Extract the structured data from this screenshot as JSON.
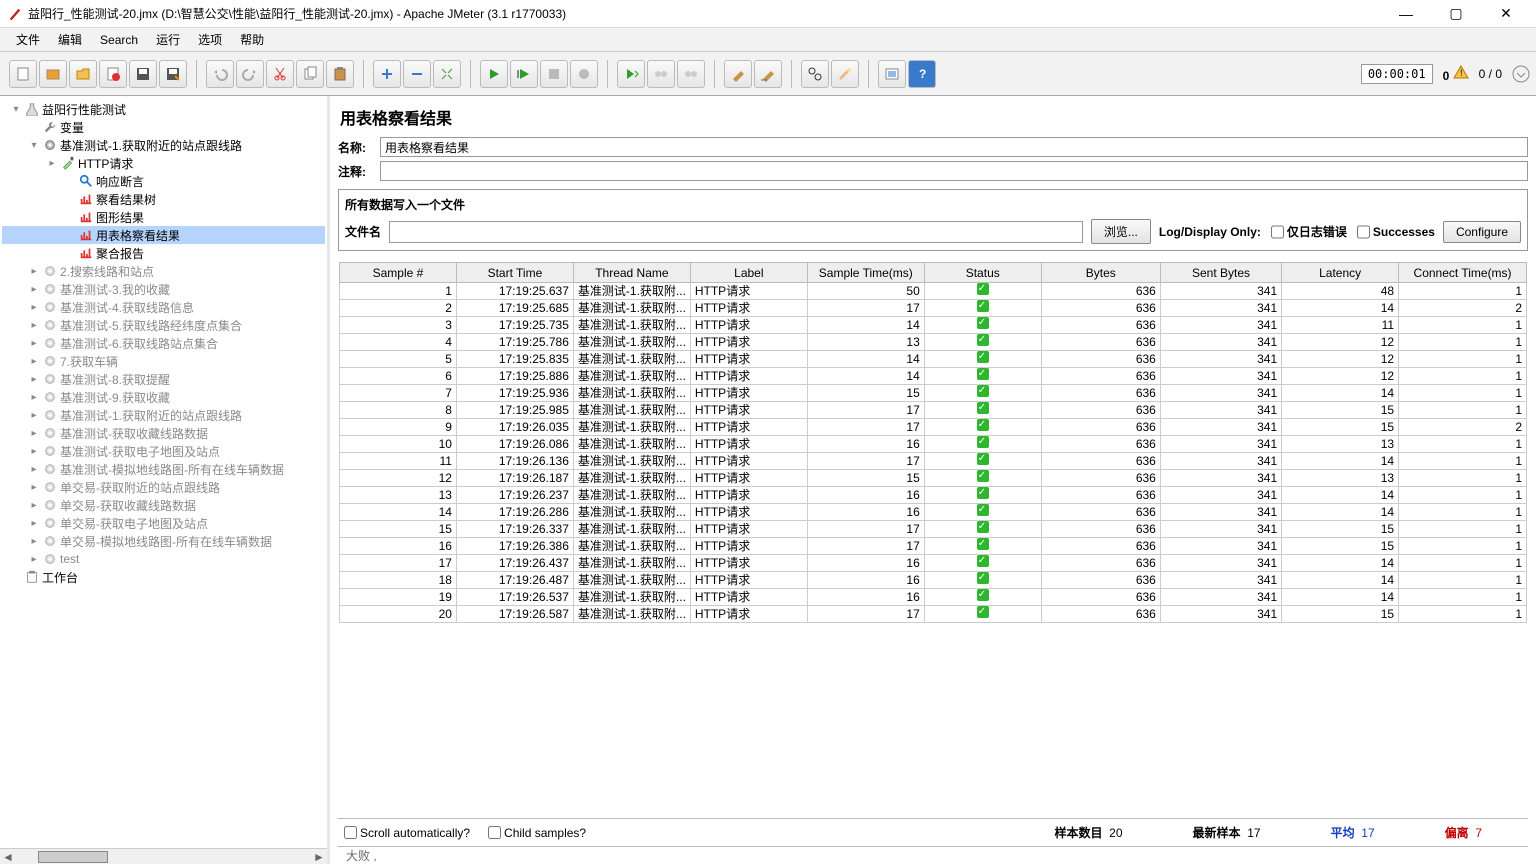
{
  "window": {
    "title": "益阳行_性能测试-20.jmx (D:\\智慧公交\\性能\\益阳行_性能测试-20.jmx) - Apache JMeter (3.1 r1770033)"
  },
  "menu": [
    "文件",
    "编辑",
    "Search",
    "运行",
    "选项",
    "帮助"
  ],
  "status": {
    "timer": "00:00:01",
    "warn_count": "0",
    "threads": "0 / 0"
  },
  "tree": [
    {
      "d": 0,
      "t": "▾",
      "ic": "flask",
      "lbl": "益阳行性能测试"
    },
    {
      "d": 1,
      "t": "",
      "ic": "wrench",
      "lbl": "变量"
    },
    {
      "d": 1,
      "t": "▾",
      "ic": "gear",
      "lbl": "基准测试-1.获取附近的站点跟线路"
    },
    {
      "d": 2,
      "t": "▸",
      "ic": "pipette",
      "lbl": "HTTP请求"
    },
    {
      "d": 3,
      "t": "",
      "ic": "lens",
      "lbl": "响应断言"
    },
    {
      "d": 3,
      "t": "",
      "ic": "chart",
      "lbl": "察看结果树"
    },
    {
      "d": 3,
      "t": "",
      "ic": "chart",
      "lbl": "图形结果"
    },
    {
      "d": 3,
      "t": "",
      "ic": "chart",
      "lbl": "用表格察看结果",
      "sel": true
    },
    {
      "d": 3,
      "t": "",
      "ic": "chart",
      "lbl": "聚合报告"
    },
    {
      "d": 1,
      "t": "▸",
      "ic": "gear-g",
      "lbl": "2.搜索线路和站点",
      "gray": true
    },
    {
      "d": 1,
      "t": "▸",
      "ic": "gear-g",
      "lbl": "基准测试-3.我的收藏",
      "gray": true
    },
    {
      "d": 1,
      "t": "▸",
      "ic": "gear-g",
      "lbl": "基准测试-4.获取线路信息",
      "gray": true
    },
    {
      "d": 1,
      "t": "▸",
      "ic": "gear-g",
      "lbl": "基准测试-5.获取线路经纬度点集合",
      "gray": true
    },
    {
      "d": 1,
      "t": "▸",
      "ic": "gear-g",
      "lbl": "基准测试-6.获取线路站点集合",
      "gray": true
    },
    {
      "d": 1,
      "t": "▸",
      "ic": "gear-g",
      "lbl": "7.获取车辆",
      "gray": true
    },
    {
      "d": 1,
      "t": "▸",
      "ic": "gear-g",
      "lbl": "基准测试-8.获取提醒",
      "gray": true
    },
    {
      "d": 1,
      "t": "▸",
      "ic": "gear-g",
      "lbl": "基准测试-9.获取收藏",
      "gray": true
    },
    {
      "d": 1,
      "t": "▸",
      "ic": "gear-g",
      "lbl": "基准测试-1.获取附近的站点跟线路",
      "gray": true
    },
    {
      "d": 1,
      "t": "▸",
      "ic": "gear-g",
      "lbl": "基准测试-获取收藏线路数据",
      "gray": true
    },
    {
      "d": 1,
      "t": "▸",
      "ic": "gear-g",
      "lbl": "基准测试-获取电子地图及站点",
      "gray": true
    },
    {
      "d": 1,
      "t": "▸",
      "ic": "gear-g",
      "lbl": "基准测试-模拟地线路图-所有在线车辆数据",
      "gray": true
    },
    {
      "d": 1,
      "t": "▸",
      "ic": "gear-g",
      "lbl": "单交易-获取附近的站点跟线路",
      "gray": true
    },
    {
      "d": 1,
      "t": "▸",
      "ic": "gear-g",
      "lbl": "单交易-获取收藏线路数据",
      "gray": true
    },
    {
      "d": 1,
      "t": "▸",
      "ic": "gear-g",
      "lbl": "单交易-获取电子地图及站点",
      "gray": true
    },
    {
      "d": 1,
      "t": "▸",
      "ic": "gear-g",
      "lbl": "单交易-模拟地线路图-所有在线车辆数据",
      "gray": true
    },
    {
      "d": 1,
      "t": "▸",
      "ic": "gear-g",
      "lbl": "test",
      "gray": true
    },
    {
      "d": 0,
      "t": "",
      "ic": "clip",
      "lbl": "工作台"
    }
  ],
  "panel": {
    "title": "用表格察看结果",
    "name_label": "名称:",
    "name_value": "用表格察看结果",
    "comment_label": "注释:",
    "comment_value": "",
    "fieldset_title": "所有数据写入一个文件",
    "filename_label": "文件名",
    "filename_value": "",
    "browse_btn": "浏览...",
    "log_only": "Log/Display Only:",
    "chk_err": "仅日志错误",
    "chk_succ": "Successes",
    "configure_btn": "Configure"
  },
  "table": {
    "headers": [
      "Sample #",
      "Start Time",
      "Thread Name",
      "Label",
      "Sample Time(ms)",
      "Status",
      "Bytes",
      "Sent Bytes",
      "Latency",
      "Connect Time(ms)"
    ],
    "rows": [
      [
        "1",
        "17:19:25.637",
        "基准测试-1.获取附...",
        "HTTP请求",
        "50",
        "ok",
        "636",
        "341",
        "48",
        "1"
      ],
      [
        "2",
        "17:19:25.685",
        "基准测试-1.获取附...",
        "HTTP请求",
        "17",
        "ok",
        "636",
        "341",
        "14",
        "2"
      ],
      [
        "3",
        "17:19:25.735",
        "基准测试-1.获取附...",
        "HTTP请求",
        "14",
        "ok",
        "636",
        "341",
        "11",
        "1"
      ],
      [
        "4",
        "17:19:25.786",
        "基准测试-1.获取附...",
        "HTTP请求",
        "13",
        "ok",
        "636",
        "341",
        "12",
        "1"
      ],
      [
        "5",
        "17:19:25.835",
        "基准测试-1.获取附...",
        "HTTP请求",
        "14",
        "ok",
        "636",
        "341",
        "12",
        "1"
      ],
      [
        "6",
        "17:19:25.886",
        "基准测试-1.获取附...",
        "HTTP请求",
        "14",
        "ok",
        "636",
        "341",
        "12",
        "1"
      ],
      [
        "7",
        "17:19:25.936",
        "基准测试-1.获取附...",
        "HTTP请求",
        "15",
        "ok",
        "636",
        "341",
        "14",
        "1"
      ],
      [
        "8",
        "17:19:25.985",
        "基准测试-1.获取附...",
        "HTTP请求",
        "17",
        "ok",
        "636",
        "341",
        "15",
        "1"
      ],
      [
        "9",
        "17:19:26.035",
        "基准测试-1.获取附...",
        "HTTP请求",
        "17",
        "ok",
        "636",
        "341",
        "15",
        "2"
      ],
      [
        "10",
        "17:19:26.086",
        "基准测试-1.获取附...",
        "HTTP请求",
        "16",
        "ok",
        "636",
        "341",
        "13",
        "1"
      ],
      [
        "11",
        "17:19:26.136",
        "基准测试-1.获取附...",
        "HTTP请求",
        "17",
        "ok",
        "636",
        "341",
        "14",
        "1"
      ],
      [
        "12",
        "17:19:26.187",
        "基准测试-1.获取附...",
        "HTTP请求",
        "15",
        "ok",
        "636",
        "341",
        "13",
        "1"
      ],
      [
        "13",
        "17:19:26.237",
        "基准测试-1.获取附...",
        "HTTP请求",
        "16",
        "ok",
        "636",
        "341",
        "14",
        "1"
      ],
      [
        "14",
        "17:19:26.286",
        "基准测试-1.获取附...",
        "HTTP请求",
        "16",
        "ok",
        "636",
        "341",
        "14",
        "1"
      ],
      [
        "15",
        "17:19:26.337",
        "基准测试-1.获取附...",
        "HTTP请求",
        "17",
        "ok",
        "636",
        "341",
        "15",
        "1"
      ],
      [
        "16",
        "17:19:26.386",
        "基准测试-1.获取附...",
        "HTTP请求",
        "17",
        "ok",
        "636",
        "341",
        "15",
        "1"
      ],
      [
        "17",
        "17:19:26.437",
        "基准测试-1.获取附...",
        "HTTP请求",
        "16",
        "ok",
        "636",
        "341",
        "14",
        "1"
      ],
      [
        "18",
        "17:19:26.487",
        "基准测试-1.获取附...",
        "HTTP请求",
        "16",
        "ok",
        "636",
        "341",
        "14",
        "1"
      ],
      [
        "19",
        "17:19:26.537",
        "基准测试-1.获取附...",
        "HTTP请求",
        "16",
        "ok",
        "636",
        "341",
        "14",
        "1"
      ],
      [
        "20",
        "17:19:26.587",
        "基准测试-1.获取附...",
        "HTTP请求",
        "17",
        "ok",
        "636",
        "341",
        "15",
        "1"
      ]
    ]
  },
  "footer": {
    "scroll_auto": "Scroll automatically?",
    "child_samples": "Child samples?",
    "samples_lbl": "样本数目",
    "samples_val": "20",
    "latest_lbl": "最新样本",
    "latest_val": "17",
    "avg_lbl": "平均",
    "avg_val": "17",
    "dev_lbl": "偏离",
    "dev_val": "7",
    "cut": "大败 ,"
  }
}
